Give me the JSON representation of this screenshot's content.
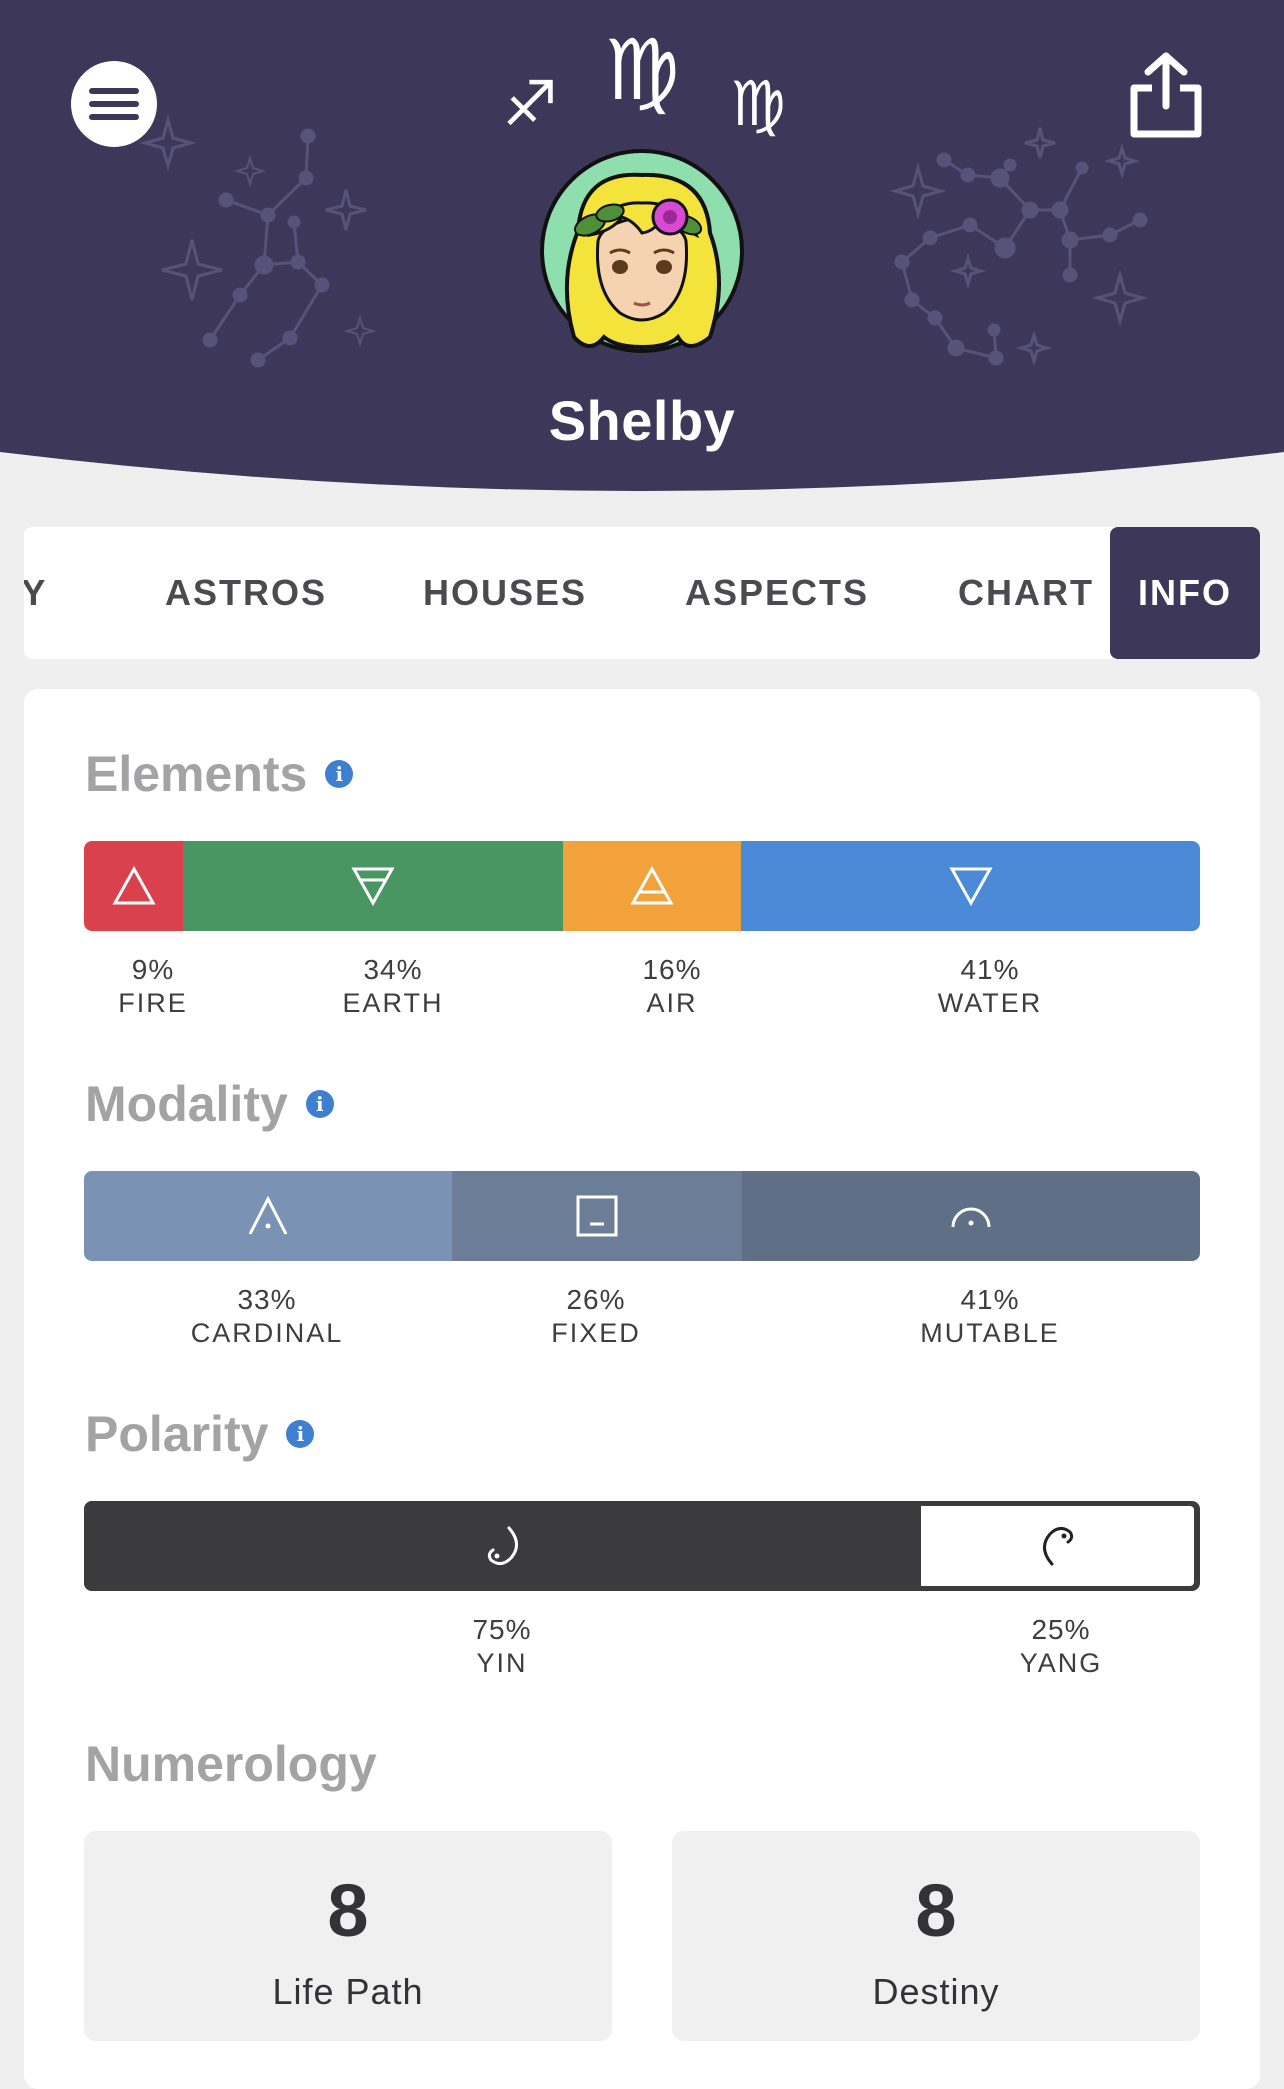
{
  "header": {
    "profile_name": "Shelby",
    "signs": {
      "left": "♐",
      "center": "♍",
      "right": "♍"
    },
    "colors": {
      "background": "#3d3859"
    }
  },
  "tabs": [
    {
      "label": "AY"
    },
    {
      "label": "ASTROS"
    },
    {
      "label": "HOUSES"
    },
    {
      "label": "ASPECTS"
    },
    {
      "label": "CHART"
    },
    {
      "label": "INFO",
      "active": true
    }
  ],
  "elements": {
    "title": "Elements",
    "items": [
      {
        "pct": "9%",
        "label": "FIRE",
        "value": 9,
        "color": "#d9414d"
      },
      {
        "pct": "34%",
        "label": "EARTH",
        "value": 34,
        "color": "#4a9662"
      },
      {
        "pct": "16%",
        "label": "AIR",
        "value": 16,
        "color": "#f2a23a"
      },
      {
        "pct": "41%",
        "label": "WATER",
        "value": 41,
        "color": "#4a8ad6"
      }
    ]
  },
  "modality": {
    "title": "Modality",
    "items": [
      {
        "pct": "33%",
        "label": "CARDINAL",
        "value": 33,
        "color": "#7a93b4"
      },
      {
        "pct": "26%",
        "label": "FIXED",
        "value": 26,
        "color": "#6c7e97"
      },
      {
        "pct": "41%",
        "label": "MUTABLE",
        "value": 41,
        "color": "#5e6f86"
      }
    ]
  },
  "polarity": {
    "title": "Polarity",
    "items": [
      {
        "pct": "75%",
        "label": "YIN",
        "value": 75,
        "color": "#3b3b3d"
      },
      {
        "pct": "25%",
        "label": "YANG",
        "value": 25,
        "color": "#ffffff"
      }
    ]
  },
  "numerology": {
    "title": "Numerology",
    "items": [
      {
        "number": "8",
        "label": "Life Path"
      },
      {
        "number": "8",
        "label": "Destiny"
      }
    ]
  }
}
